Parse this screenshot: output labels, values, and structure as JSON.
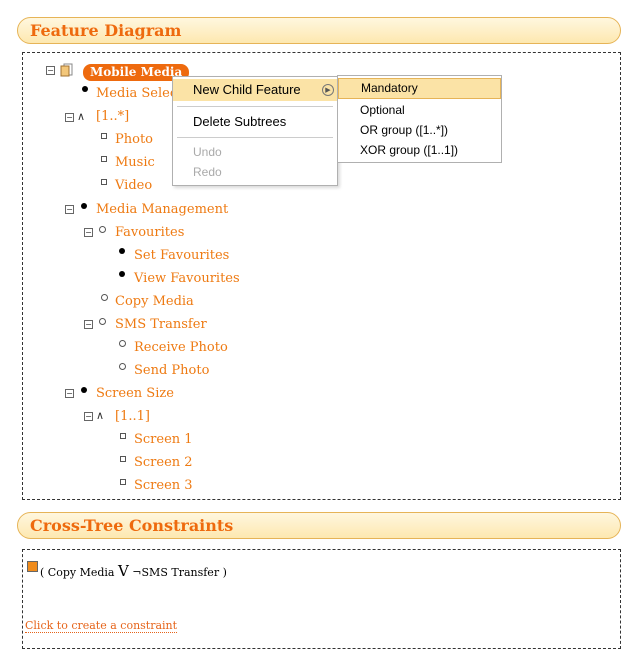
{
  "feature_panel": {
    "title": "Feature Diagram"
  },
  "tree": {
    "root": "Mobile Media",
    "media_selection": "Media Selection",
    "group_1": "[1..*]",
    "photo": "Photo",
    "music": "Music",
    "video": "Video",
    "media_management": "Media Management",
    "favourites": "Favourites",
    "set_favourites": "Set Favourites",
    "view_favourites": "View Favourites",
    "copy_media": "Copy Media",
    "sms_transfer": "SMS Transfer",
    "receive_photo": "Receive Photo",
    "send_photo": "Send Photo",
    "screen_size": "Screen Size",
    "group_2": "[1..1]",
    "screen1": "Screen 1",
    "screen2": "Screen 2",
    "screen3": "Screen 3"
  },
  "context_menu": {
    "new_child": "New Child Feature",
    "delete_subtrees": "Delete Subtrees",
    "undo": "Undo",
    "redo": "Redo"
  },
  "submenu": {
    "mandatory": "Mandatory",
    "optional": "Optional",
    "or_group": "OR group ([1..*])",
    "xor_group": "XOR group ([1..1])"
  },
  "constraints_panel": {
    "title": "Cross-Tree Constraints",
    "constraint_left": "( Copy Media ",
    "or_symbol": "V",
    "constraint_right": " ¬SMS Transfer )",
    "create_link": "Click to create a constraint"
  },
  "colors": {
    "accent": "#ee6a0e",
    "highlight": "#fbe3a6"
  }
}
